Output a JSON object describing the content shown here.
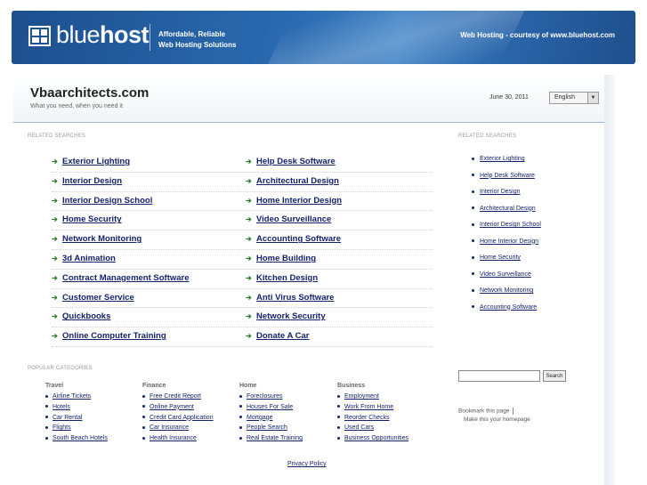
{
  "banner": {
    "logo_light": "blue",
    "logo_bold": "host",
    "tagline_line1": "Affordable, Reliable",
    "tagline_line2": "Web Hosting Solutions",
    "courtesy": "Web Hosting - courtesy of www.bluehost.com"
  },
  "header": {
    "title": "Vbaarchitects.com",
    "subtitle": "What you need, when you need it",
    "date": "June 30, 2011",
    "language": "English"
  },
  "related_label": "RELATED SEARCHES",
  "searches": [
    [
      "Exterior Lighting",
      "Help Desk Software"
    ],
    [
      "Interior Design",
      "Architectural Design"
    ],
    [
      "Interior Design School",
      "Home Interior Design"
    ],
    [
      "Home Security",
      "Video Surveillance"
    ],
    [
      "Network Monitoring",
      "Accounting Software"
    ],
    [
      "3d Animation",
      "Home Building"
    ],
    [
      "Contract Management Software",
      "Kitchen Design"
    ],
    [
      "Customer Service",
      "Anti Virus Software"
    ],
    [
      "Quickbooks",
      "Network Security"
    ],
    [
      "Online Computer Training",
      "Donate A Car"
    ]
  ],
  "sidebar_label": "RELATED SEARCHES",
  "sidebar_links": [
    "Exterior Lighting",
    "Help Desk Software",
    "Interior Design",
    "Architectural Design",
    "Interior Design School",
    "Home Interior Design",
    "Home Security",
    "Video Surveillance",
    "Network Monitoring",
    "Accounting Software"
  ],
  "popular_label": "POPULAR CATEGORIES",
  "categories": [
    {
      "name": "Travel",
      "items": [
        "Airline Tickets",
        "Hotels",
        "Car Rental",
        "Flights",
        "South Beach Hotels"
      ]
    },
    {
      "name": "Finance",
      "items": [
        "Free Credit Report",
        "Online Payment",
        "Credit Card Application",
        "Car Insurance",
        "Health Insurance"
      ]
    },
    {
      "name": "Home",
      "items": [
        "Foreclosures",
        "Houses For Sale",
        "Mortgage",
        "People Search",
        "Real Estate Training"
      ]
    },
    {
      "name": "Business",
      "items": [
        "Employment",
        "Work From Home",
        "Reorder Checks",
        "Used Cars",
        "Business Opportunities"
      ]
    }
  ],
  "search_button": "Search",
  "bookmark": "Bookmark this page",
  "homepage": "Make this your homepage",
  "privacy": "Privacy Policy",
  "colors": {
    "link": "#14226c",
    "banner": "#2b6bb1",
    "arrow": "#2d7a2d"
  }
}
